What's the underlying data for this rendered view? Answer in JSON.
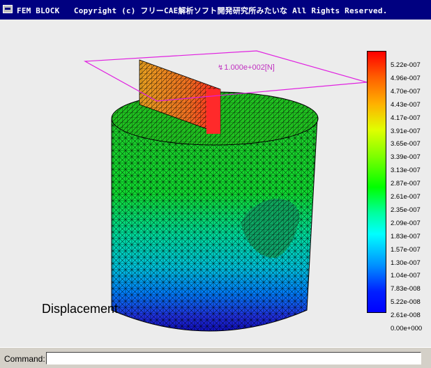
{
  "window": {
    "title": "FEM BLOCK   Copyright (c) フリーCAE解析ソフト開発研究所みたいな All Rights Reserved.",
    "icon": "app-window-icon"
  },
  "viewport": {
    "result_label": "Displacement",
    "force_label": "1.000e+002[N]",
    "force_icon": "force-arrow-icon",
    "colors": {
      "background": "#ececec",
      "load_plane": "#e020e0"
    }
  },
  "colorbar": {
    "ticks": [
      "5.22e-007",
      "4.96e-007",
      "4.70e-007",
      "4.43e-007",
      "4.17e-007",
      "3.91e-007",
      "3.65e-007",
      "3.39e-007",
      "3.13e-007",
      "2.87e-007",
      "2.61e-007",
      "2.35e-007",
      "2.09e-007",
      "1.83e-007",
      "1.57e-007",
      "1.30e-007",
      "1.04e-007",
      "7.83e-008",
      "5.22e-008",
      "2.61e-008",
      "0.00e+000"
    ],
    "top_color": "#ff0000",
    "bottom_color": "#0000ff"
  },
  "command": {
    "label": "Command:",
    "value": ""
  }
}
